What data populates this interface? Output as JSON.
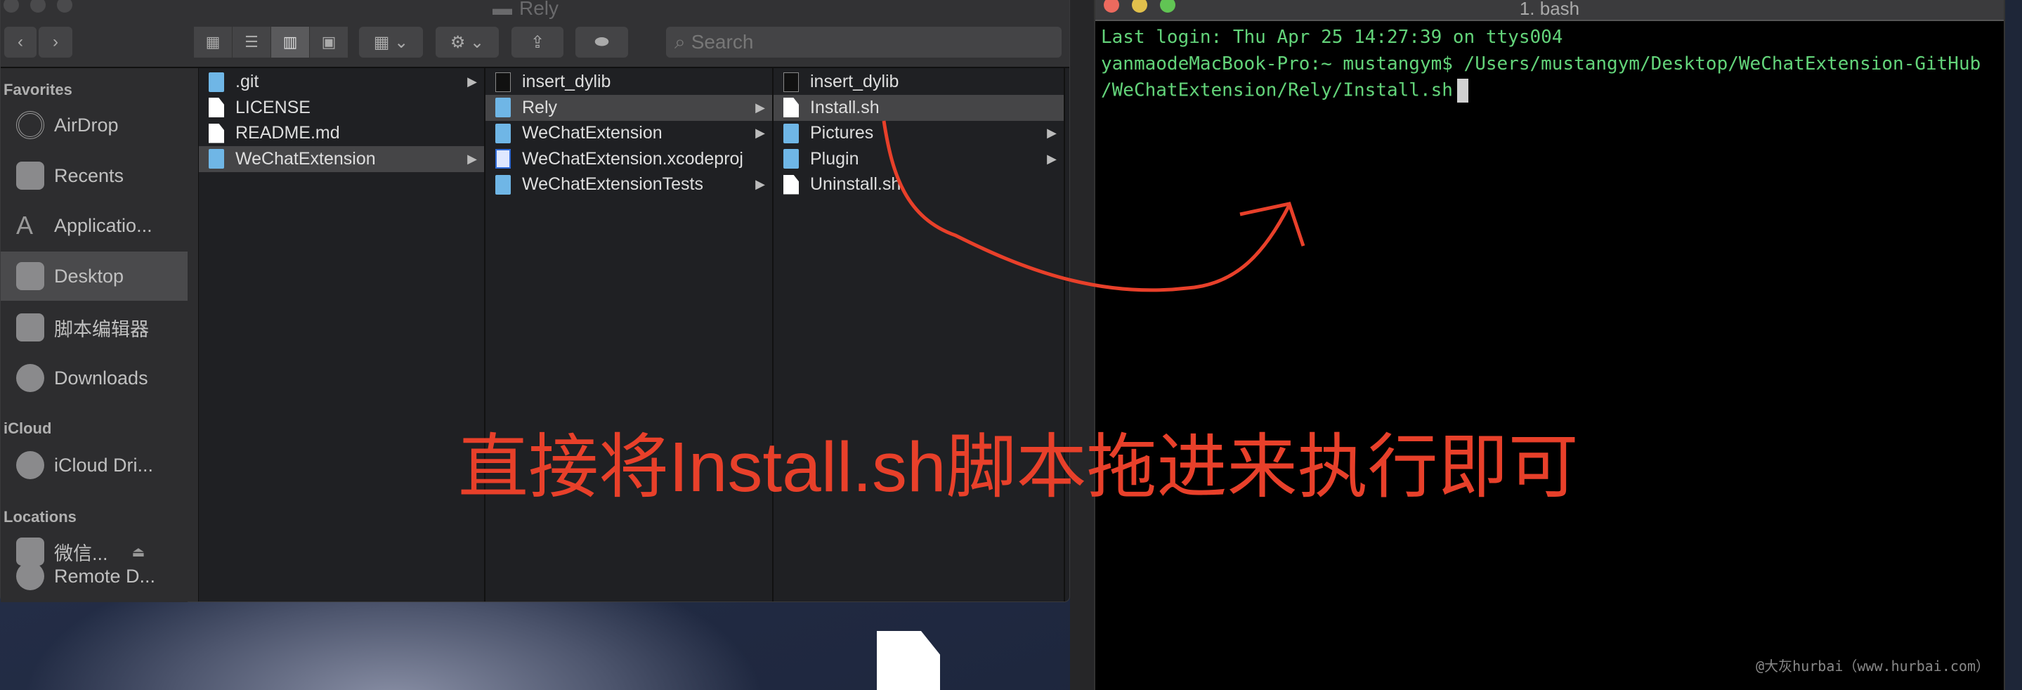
{
  "finder": {
    "title": "Rely",
    "search_placeholder": "Search",
    "sidebar": {
      "favorites_label": "Favorites",
      "favorites": [
        "AirDrop",
        "Recents",
        "Applicatio...",
        "Desktop",
        "脚本编辑器",
        "Downloads"
      ],
      "icloud_label": "iCloud",
      "icloud": [
        "iCloud Dri..."
      ],
      "locations_label": "Locations",
      "locations": [
        "微信...",
        "Remote D..."
      ],
      "selected": "Desktop"
    },
    "columns": [
      [
        {
          "name": ".git",
          "type": "folder"
        },
        {
          "name": "LICENSE",
          "type": "file"
        },
        {
          "name": "README.md",
          "type": "file"
        },
        {
          "name": "WeChatExtension",
          "type": "folder",
          "selected": true
        }
      ],
      [
        {
          "name": "insert_dylib",
          "type": "exec"
        },
        {
          "name": "Rely",
          "type": "folder",
          "selected": true
        },
        {
          "name": "WeChatExtension",
          "type": "folder"
        },
        {
          "name": "WeChatExtension.xcodeproj",
          "type": "xcode"
        },
        {
          "name": "WeChatExtensionTests",
          "type": "folder"
        }
      ],
      [
        {
          "name": "insert_dylib",
          "type": "exec"
        },
        {
          "name": "Install.sh",
          "type": "file",
          "selected": true
        },
        {
          "name": "Pictures",
          "type": "folder"
        },
        {
          "name": "Plugin",
          "type": "folder"
        },
        {
          "name": "Uninstall.sh",
          "type": "file"
        }
      ]
    ]
  },
  "terminal": {
    "title": "1. bash",
    "lines": [
      "Last login: Thu Apr 25 14:27:39 on ttys004",
      "yanmaodeMacBook-Pro:~ mustangym$ /Users/mustangym/Desktop/WeChatExtension-GitHub",
      "/WeChatExtension/Rely/Install.sh"
    ],
    "text_color": "#63d47a"
  },
  "annotation": {
    "text": "直接将Install.sh脚本拖进来执行即可",
    "color": "#e8402a"
  },
  "watermark": "@大灰hurbai（www.hurbai.com）"
}
